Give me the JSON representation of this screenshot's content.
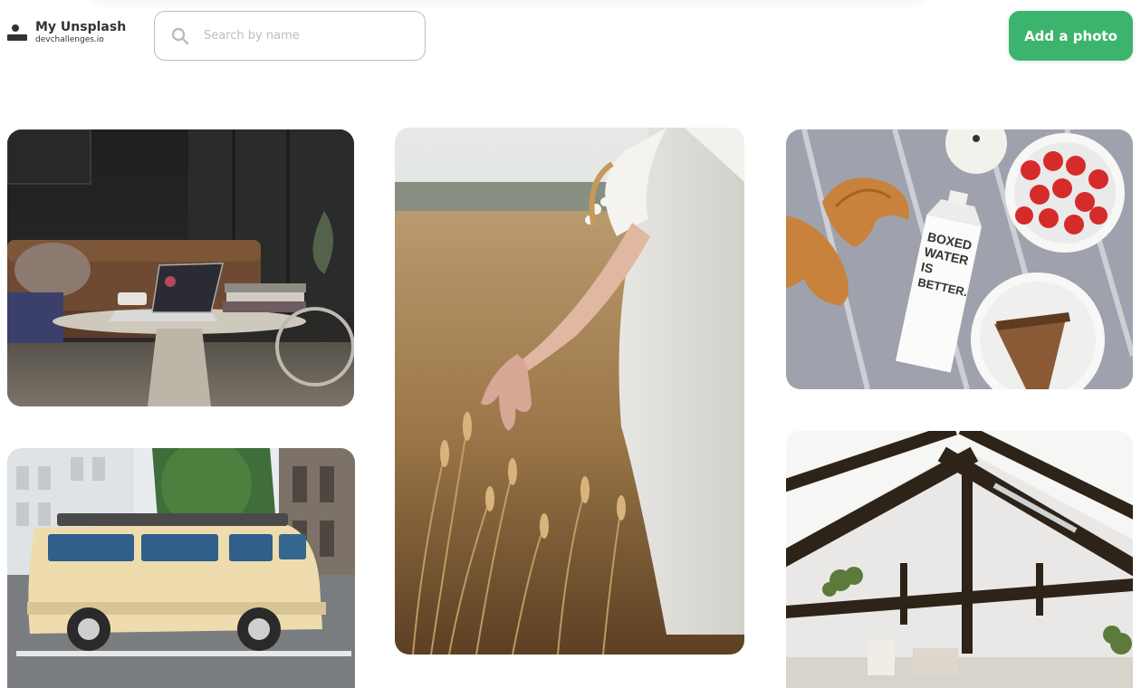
{
  "app": {
    "title": "My Unsplash",
    "subtitle": "devchallenges.io"
  },
  "search": {
    "placeholder": "Search by name",
    "value": "",
    "icon": "search-icon"
  },
  "header": {
    "add_label": "Add a photo",
    "accent_color": "#3db46d"
  },
  "gallery": {
    "photos": [
      {
        "subject": "living room with laptop on coffee table"
      },
      {
        "subject": "woman in white dress walking through wheat field"
      },
      {
        "subject": "croissants, strawberries and carton"
      },
      {
        "subject": "cream camper van in parking lot"
      },
      {
        "subject": "white room with dark wooden roof beams"
      }
    ],
    "carton_text": [
      "BOXED",
      "WATER",
      "IS",
      "BETTER."
    ]
  }
}
